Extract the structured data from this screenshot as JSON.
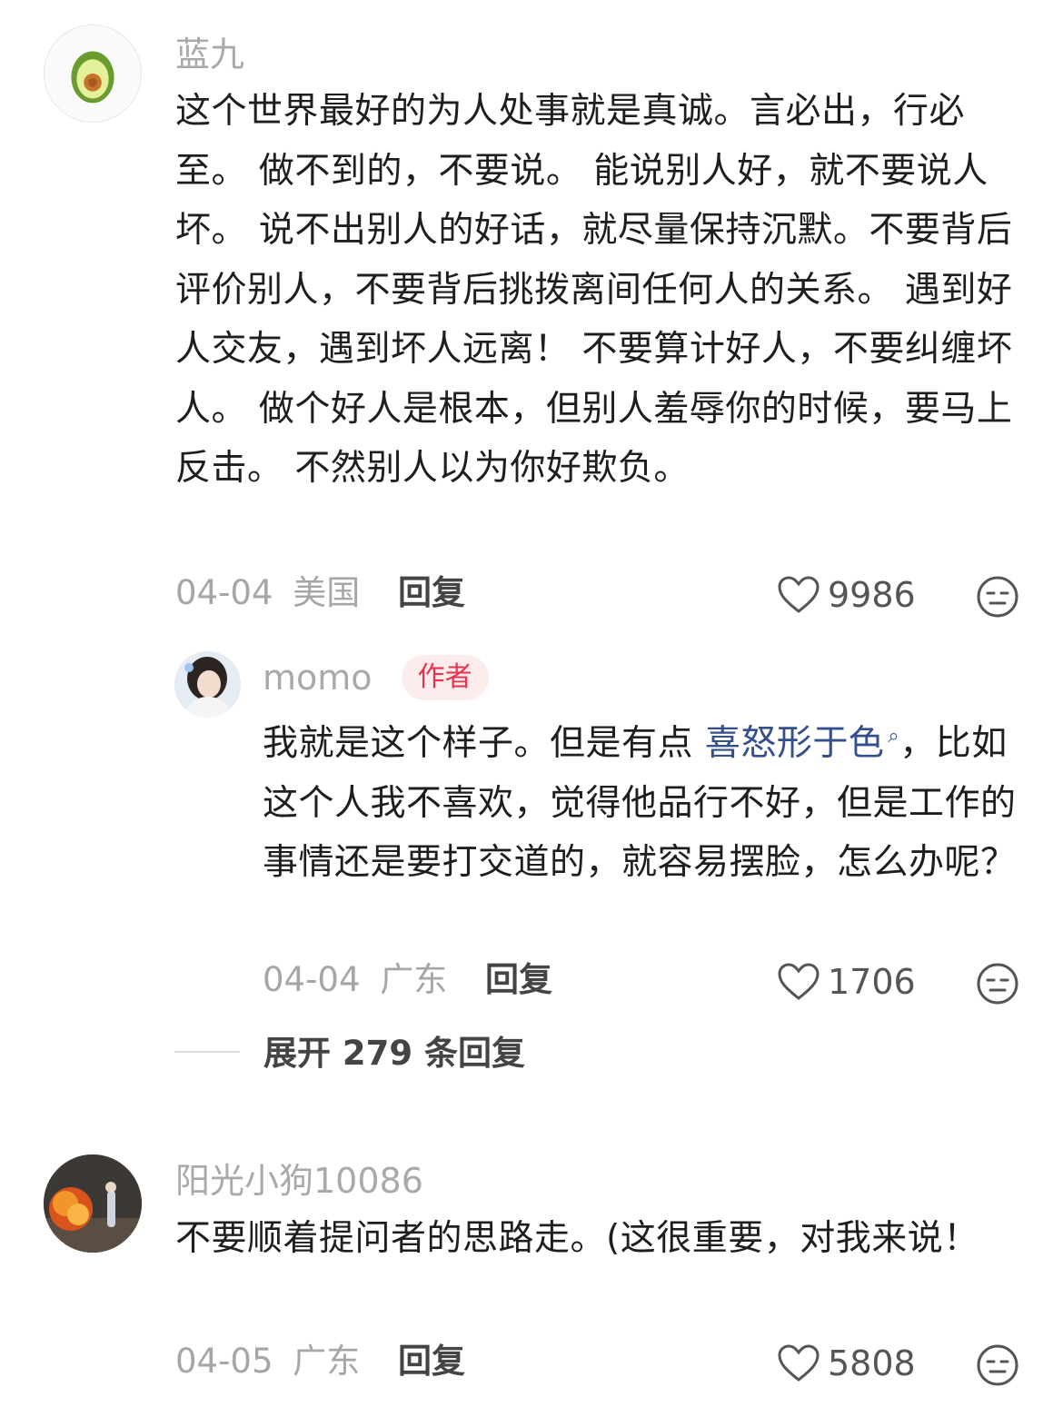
{
  "comments": [
    {
      "username": "蓝九",
      "content": "这个世界最好的为人处事就是真诚。言必出，行必至。 做不到的，不要说。 能说别人好，就不要说人坏。 说不出别人的好话，就尽量保持沉默。不要背后评价别人，不要背后挑拨离间任何人的关系。 遇到好人交友，遇到坏人远离！ 不要算计好人，不要纠缠坏人。 做个好人是根本，但别人羞辱你的时候，要马上反击。 不然别人以为你好欺负。",
      "date": "04-04",
      "location": "美国",
      "reply_label": "回复",
      "likes": "9986"
    },
    {
      "username": "阳光小狗10086",
      "content": "不要顺着提问者的思路走。(这很重要，对我来说！",
      "date": "04-05",
      "location": "广东",
      "reply_label": "回复",
      "likes": "5808"
    }
  ],
  "reply": {
    "username": "momo",
    "badge": "作者",
    "content_before": "我就是这个样子。但是有点 ",
    "content_link": "喜怒形于色",
    "content_after": "，比如这个人我不喜欢，觉得他品行不好，但是工作的事情还是要打交道的，就容易摆脸，怎么办呢？",
    "date": "04-04",
    "location": "广东",
    "reply_label": "回复",
    "likes": "1706"
  },
  "expand_label": "展开 279 条回复",
  "icons": {
    "like": "heart-outline-icon",
    "dislike": "neutral-face-icon",
    "link": "search-icon"
  },
  "colors": {
    "badge_text": "#e8324b",
    "badge_bg": "#fdecec",
    "link": "#33508c",
    "muted": "#a6a6a6"
  }
}
